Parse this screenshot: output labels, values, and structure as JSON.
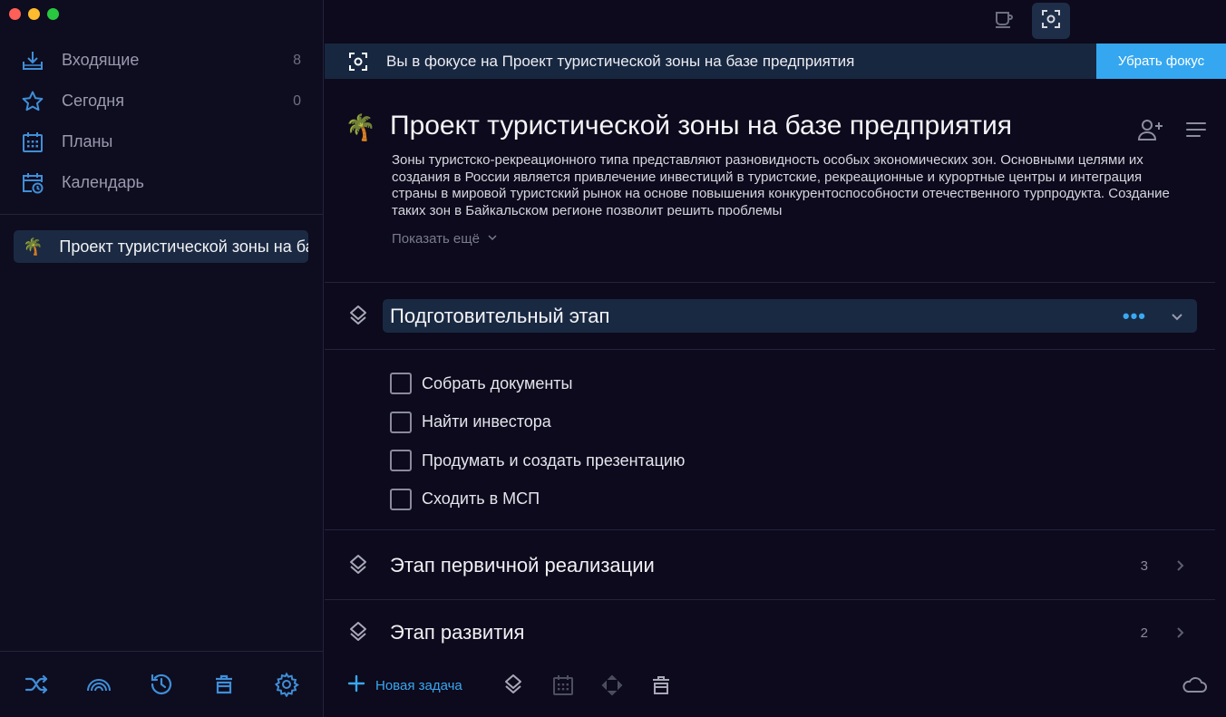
{
  "sidebar": {
    "nav": [
      {
        "label": "Входящие",
        "count": "8",
        "icon": "inbox-icon"
      },
      {
        "label": "Сегодня",
        "count": "0",
        "icon": "star-icon"
      },
      {
        "label": "Планы",
        "count": "",
        "icon": "plans-calendar-icon"
      },
      {
        "label": "Календарь",
        "count": "",
        "icon": "calendar-clock-icon"
      }
    ],
    "project": {
      "emoji": "🌴",
      "label": "Проект туристической зоны на базе предприятия"
    },
    "bottom_icons": [
      "shuffle-icon",
      "rainbow-icon",
      "history-icon",
      "trash-icon",
      "gear-icon"
    ]
  },
  "focus": {
    "text": "Вы в фокусе на Проект туристической зоны на базе предприятия",
    "button": "Убрать фокус"
  },
  "project": {
    "emoji": "🌴",
    "title": "Проект туристической зоны на базе предприятия",
    "description": "Зоны туристско-рекреационного типа представляют разновидность особых экономических зон. Основными целями их создания в России является привлечение инвестиций в туристские, рекреационные и курортные центры и интеграция страны в мировой туристский рынок на основе повышения конкурентоспособности отечественного турпродукта. Создание таких зон в Байкальском регионе позволит решить проблемы",
    "show_more": "Показать ещё"
  },
  "sections": [
    {
      "title": "Подготовительный этап",
      "expanded": true,
      "tasks": [
        {
          "label": "Собрать документы",
          "done": false
        },
        {
          "label": "Найти инвестора",
          "done": false
        },
        {
          "label": "Продумать и создать презентацию",
          "done": false
        },
        {
          "label": "Сходить в МСП",
          "done": false
        }
      ]
    },
    {
      "title": "Этап первичной реализации",
      "count": "3",
      "expanded": false
    },
    {
      "title": "Этап развития",
      "count": "2",
      "expanded": false
    }
  ],
  "bottombar": {
    "new_task": "Новая задача"
  },
  "colors": {
    "accent": "#35a7f0",
    "background": "#0c0a1c",
    "selected": "#1b2a42"
  }
}
